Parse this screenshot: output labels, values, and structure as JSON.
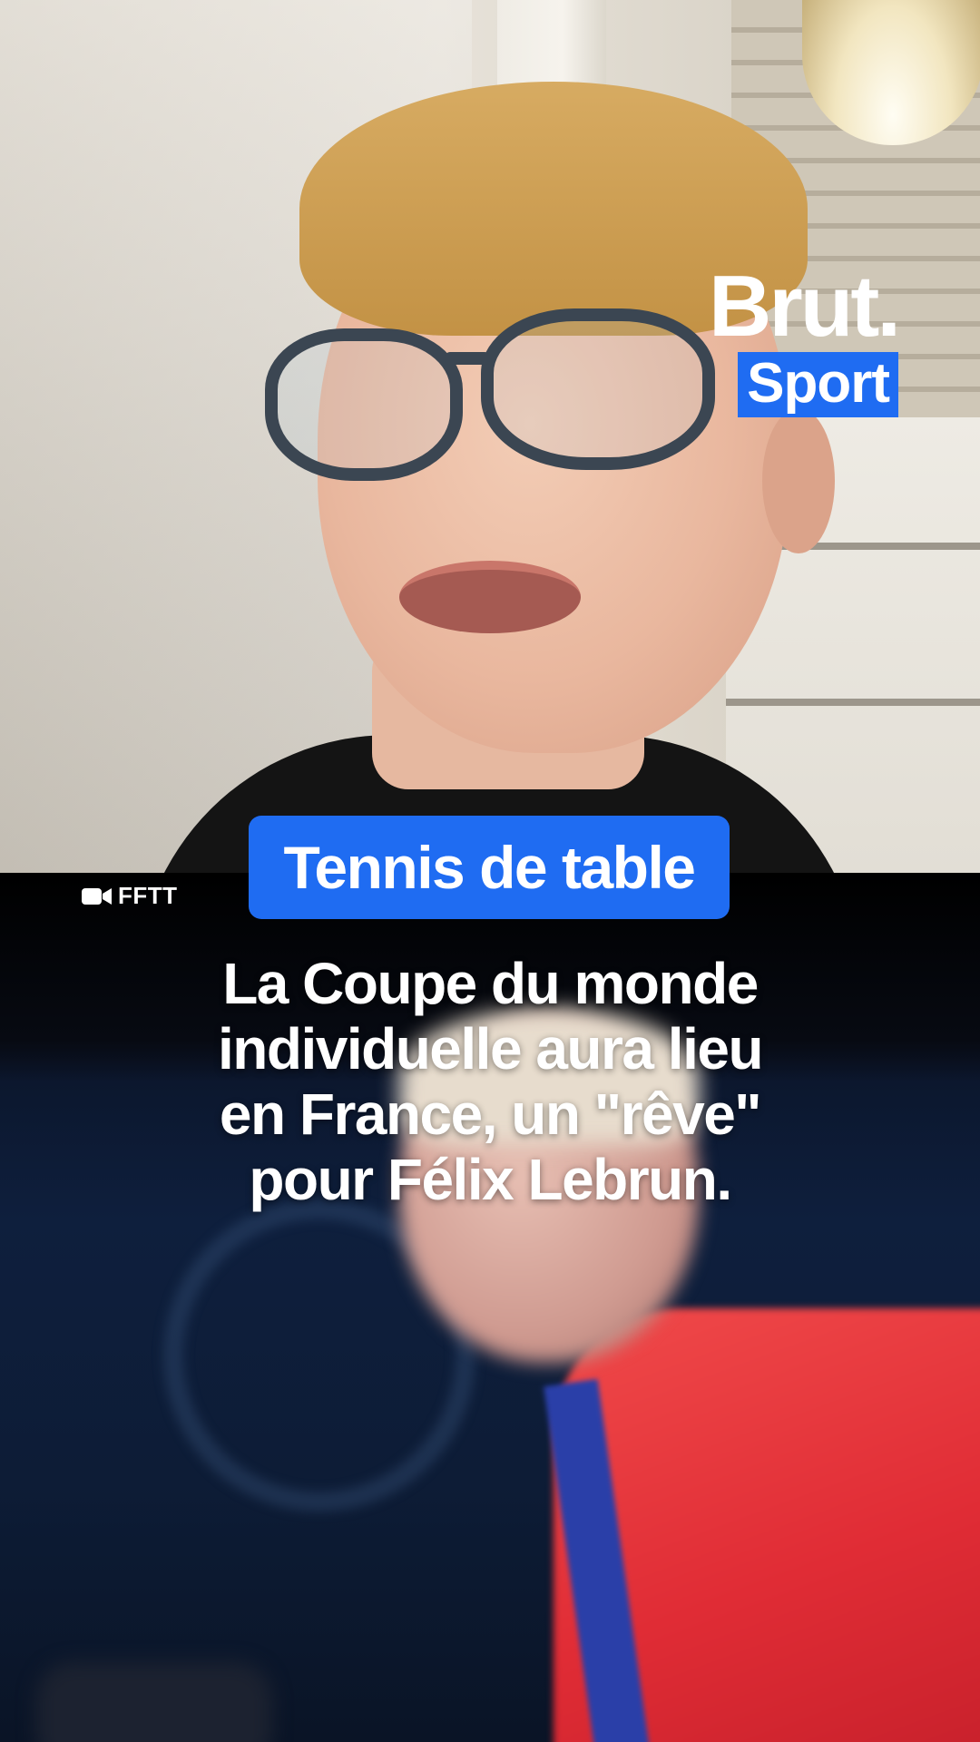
{
  "brand": {
    "name": "Brut.",
    "section": "Sport",
    "accent_color": "#1f6cf2"
  },
  "category": {
    "label": "Tennis de table"
  },
  "credit": {
    "icon": "video-camera-icon",
    "label": "FFTT"
  },
  "caption": {
    "lines": [
      "La Coupe du monde",
      "individuelle aura lieu",
      "en France, un \"rêve\"",
      "pour Félix Lebrun."
    ]
  }
}
